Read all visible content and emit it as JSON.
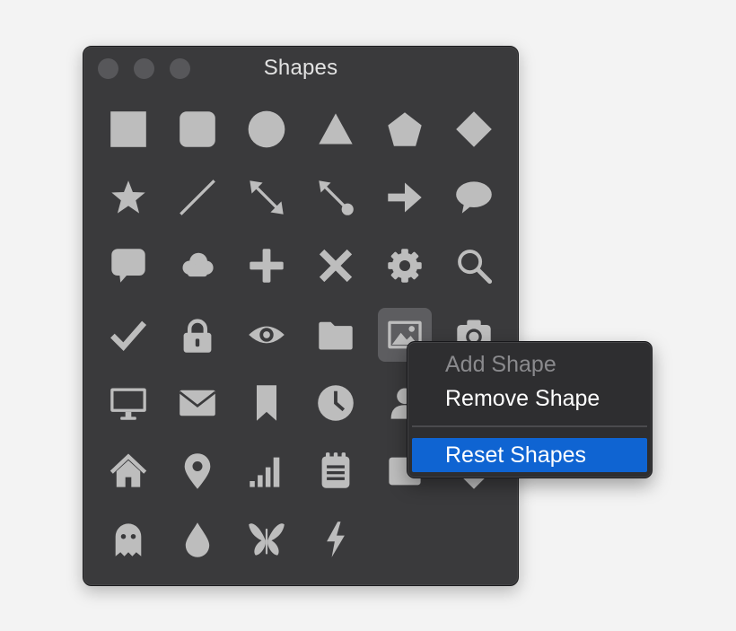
{
  "window": {
    "title": "Shapes",
    "traffic_lights": [
      "close",
      "minimize",
      "zoom"
    ]
  },
  "palette": {
    "selected_index": 22,
    "icons": [
      "square-icon",
      "rounded-square-icon",
      "circle-icon",
      "triangle-icon",
      "pentagon-icon",
      "diamond-icon",
      "star-icon",
      "line-icon",
      "double-arrow-line-icon",
      "line-with-dot-icon",
      "right-arrow-icon",
      "speech-bubble-icon",
      "chat-bubble-icon",
      "cloud-icon",
      "plus-icon",
      "x-icon",
      "gear-icon",
      "magnifier-icon",
      "checkmark-icon",
      "lock-icon",
      "eye-icon",
      "folder-icon",
      "image-icon",
      "camera-icon",
      "monitor-icon",
      "envelope-icon",
      "bookmark-icon",
      "clock-icon",
      "person-icon",
      "partially-hidden-icon",
      "house-icon",
      "location-pin-icon",
      "signal-bars-icon",
      "notepad-icon",
      "partially-hidden-icon-2",
      "partially-hidden-icon-3",
      "ghost-icon",
      "drop-icon",
      "butterfly-icon",
      "lightning-icon"
    ]
  },
  "context_menu": {
    "items": [
      {
        "label": "Add Shape",
        "state": "disabled"
      },
      {
        "label": "Remove Shape",
        "state": "normal"
      },
      {
        "label": "Reset Shapes",
        "state": "highlighted"
      }
    ]
  },
  "colors": {
    "window_bg": "#3a3a3c",
    "icon": "#bdbdbd",
    "highlight": "#0f64d2",
    "page_bg": "#f3f3f3"
  }
}
